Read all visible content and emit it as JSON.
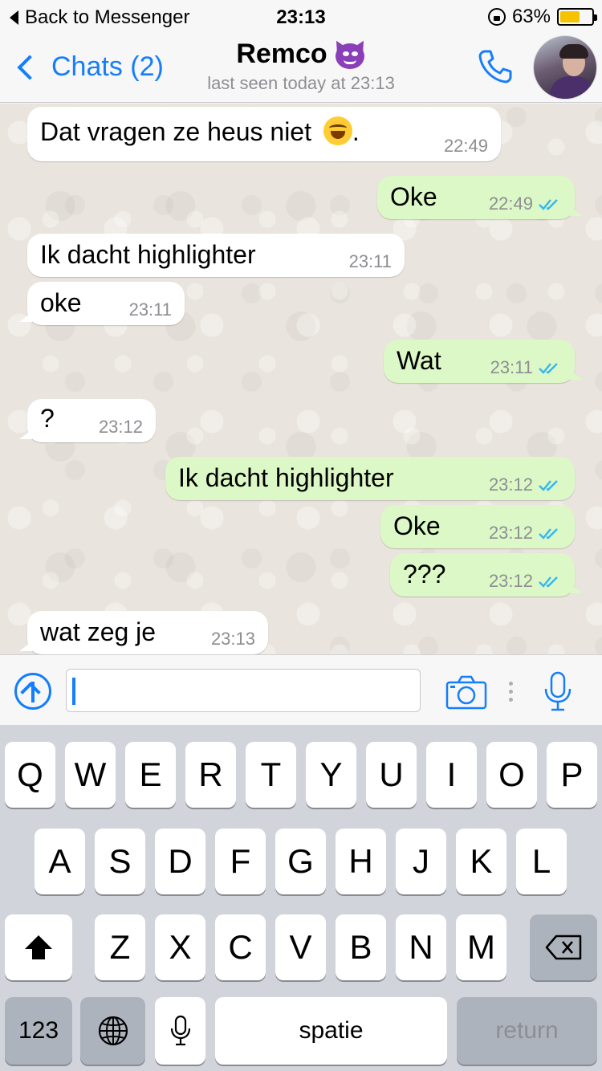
{
  "status_bar": {
    "back_label": "Back to Messenger",
    "time": "23:13",
    "battery_percent": "63%",
    "battery_level": 0.63,
    "battery_color": "#f5c400"
  },
  "nav": {
    "back_label": "Chats (2)",
    "contact_name": "Remco",
    "contact_emoji": "smiling-imp-devil",
    "last_seen": "last seen today at 23:13",
    "call_icon": "phone-icon"
  },
  "colors": {
    "accent": "#147efb",
    "incoming_bubble": "#ffffff",
    "outgoing_bubble": "#dcf8c6",
    "read_ticks": "#34b7f1",
    "chat_background": "#e9e4dd"
  },
  "messages": [
    {
      "direction": "in",
      "text": "Dat vragen ze heus niet",
      "suffix": ".",
      "emoji": "face-with-tears-of-joy",
      "time": "22:49"
    },
    {
      "direction": "out",
      "text": "Oke",
      "time": "22:49",
      "status": "read"
    },
    {
      "direction": "in",
      "text": "Ik dacht highlighter",
      "time": "23:11"
    },
    {
      "direction": "in",
      "text": "oke",
      "time": "23:11"
    },
    {
      "direction": "out",
      "text": "Wat",
      "time": "23:11",
      "status": "read"
    },
    {
      "direction": "in",
      "text": "?",
      "time": "23:12"
    },
    {
      "direction": "out",
      "text": "Ik dacht highlighter",
      "time": "23:12",
      "status": "read"
    },
    {
      "direction": "out",
      "text": "Oke",
      "time": "23:12",
      "status": "read"
    },
    {
      "direction": "out",
      "text": "???",
      "time": "23:12",
      "status": "read"
    },
    {
      "direction": "in",
      "text": "wat zeg je",
      "time": "23:13"
    }
  ],
  "input_bar": {
    "attach_icon": "upload-arrow-icon",
    "message_value": "",
    "camera_icon": "camera-icon",
    "mic_icon": "microphone-icon"
  },
  "keyboard": {
    "row1": [
      "Q",
      "W",
      "E",
      "R",
      "T",
      "Y",
      "U",
      "I",
      "O",
      "P"
    ],
    "row2": [
      "A",
      "S",
      "D",
      "F",
      "G",
      "H",
      "J",
      "K",
      "L"
    ],
    "row3": [
      "Z",
      "X",
      "C",
      "V",
      "B",
      "N",
      "M"
    ],
    "shift_icon": "shift-arrow-icon",
    "delete_icon": "backspace-icon",
    "numbers_label": "123",
    "globe_icon": "globe-icon",
    "dictation_icon": "microphone-icon",
    "space_label": "spatie",
    "return_label": "return"
  }
}
